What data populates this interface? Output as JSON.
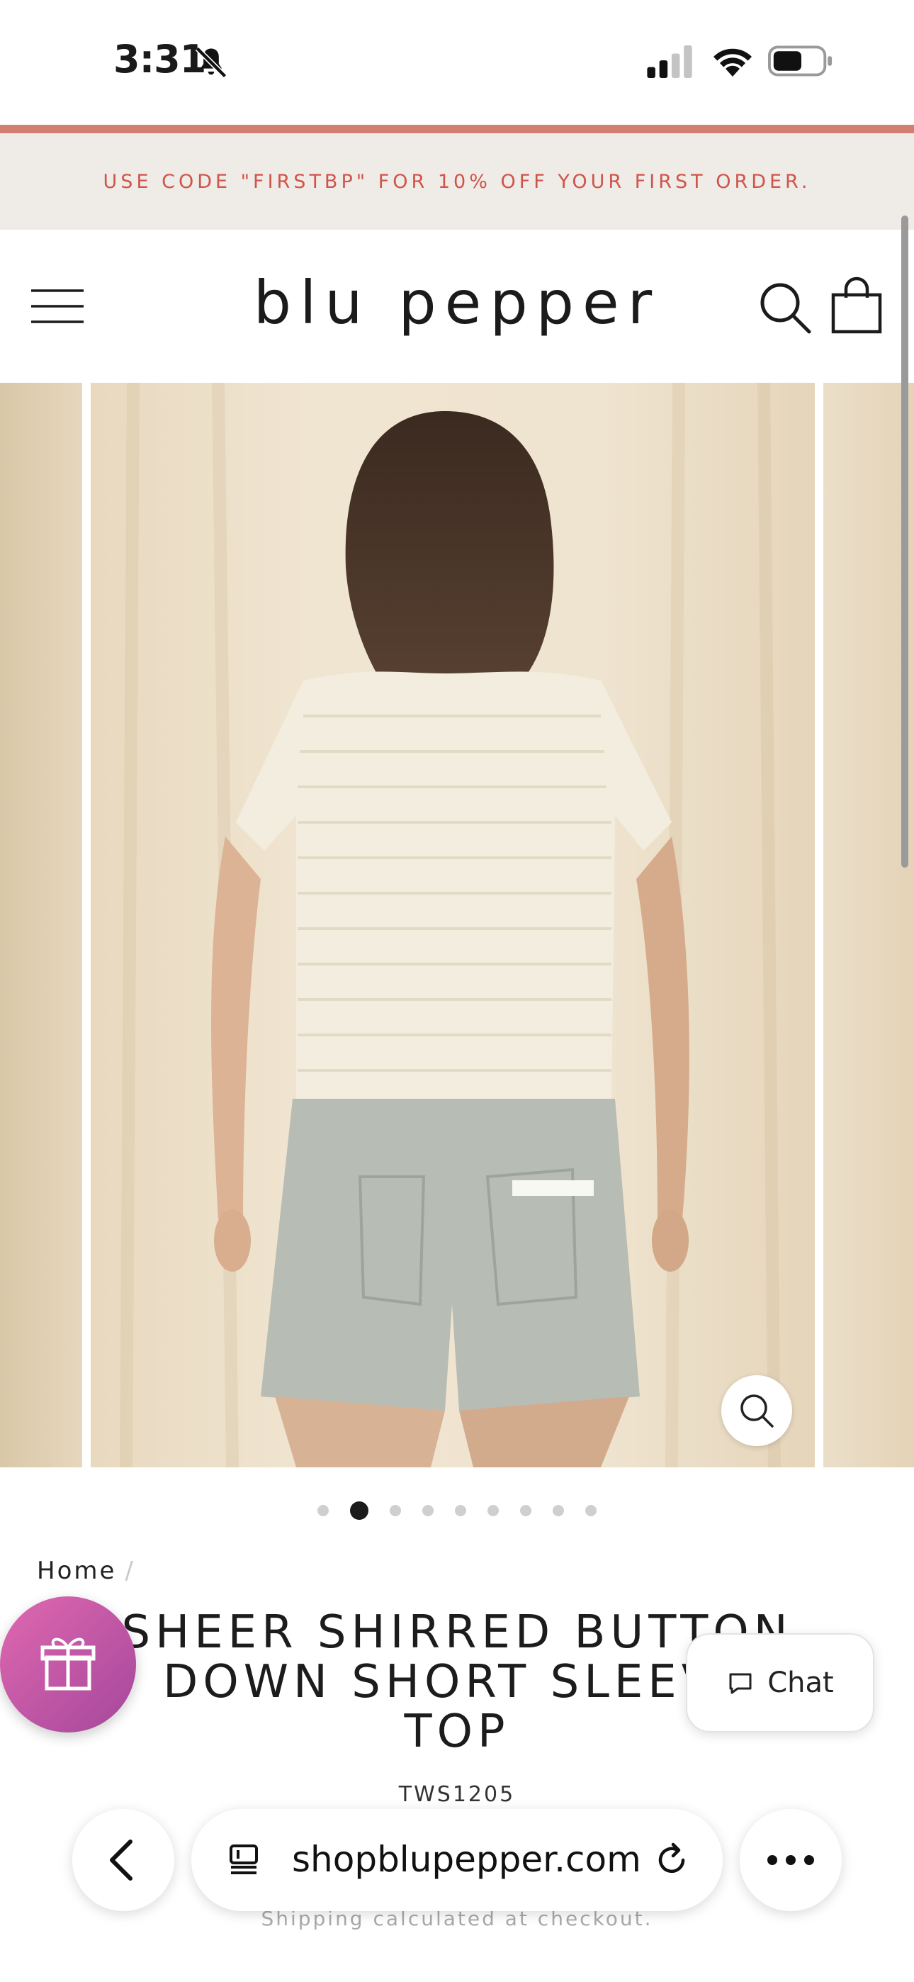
{
  "status_bar": {
    "time": "3:31"
  },
  "promo": {
    "text": "USE CODE \"FIRSTBP\" FOR 10% OFF YOUR FIRST ORDER."
  },
  "header": {
    "logo": "blu pepper"
  },
  "gallery": {
    "slide_count": 9,
    "active_index": 1
  },
  "breadcrumb": {
    "home": "Home",
    "separator": "/"
  },
  "product": {
    "title_line1": "SHEER SHIRRED BUTTON",
    "title_line2": "DOWN SHORT SLEEVE",
    "title_line3": "TOP",
    "sku": "TWS1205",
    "shipping_note": "Shipping calculated at checkout."
  },
  "chat": {
    "label": "Chat"
  },
  "browser": {
    "url": "shopblupepper.com"
  },
  "colors": {
    "accent": "#d27f72",
    "promo_text": "#d0544a",
    "promo_bg": "#efebe6",
    "gift_gradient_start": "#e068b0",
    "gift_gradient_end": "#a4479b"
  },
  "icons": [
    "bell-slash-icon",
    "signal-icon",
    "wifi-icon",
    "battery-icon",
    "menu-icon",
    "search-icon",
    "cart-icon",
    "zoom-icon",
    "gift-icon",
    "chat-bubble-icon",
    "back-chevron-icon",
    "tabs-icon",
    "reload-icon",
    "more-icon"
  ]
}
